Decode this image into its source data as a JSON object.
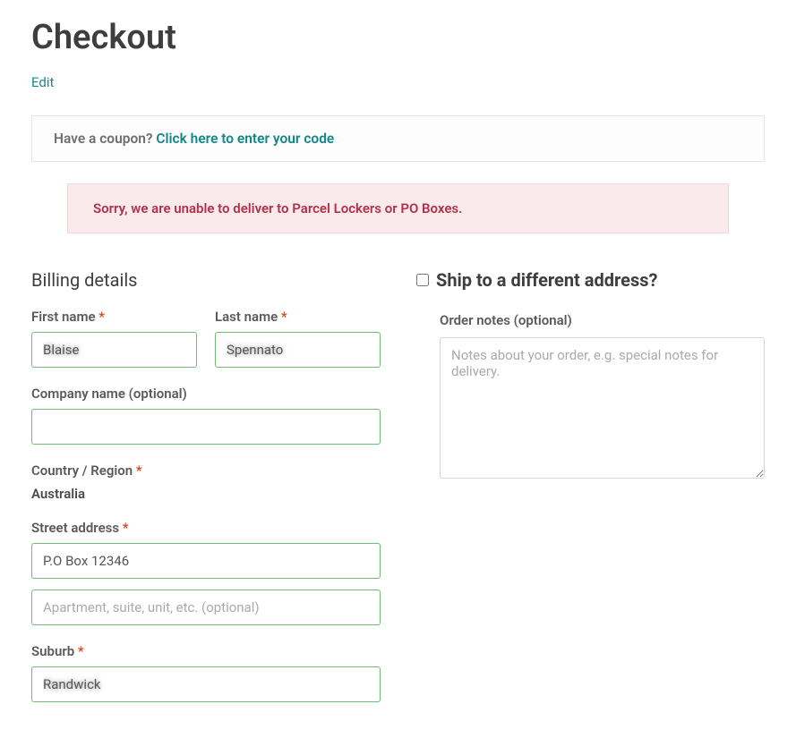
{
  "page": {
    "title": "Checkout",
    "edit_link": "Edit"
  },
  "coupon": {
    "prompt": "Have a coupon? ",
    "link": "Click here to enter your code"
  },
  "error": {
    "message": "Sorry, we are unable to deliver to Parcel Lockers or PO Boxes."
  },
  "billing": {
    "heading": "Billing details",
    "first_name": {
      "label": "First name ",
      "value": "Blaise"
    },
    "last_name": {
      "label": "Last name ",
      "value": "Spennato"
    },
    "company": {
      "label": "Company name (optional)",
      "value": ""
    },
    "country": {
      "label": "Country / Region ",
      "value": "Australia"
    },
    "street": {
      "label": "Street address ",
      "value": "P.O Box 12346",
      "placeholder2": "Apartment, suite, unit, etc. (optional)"
    },
    "suburb": {
      "label": "Suburb ",
      "value": "Randwick"
    },
    "required_marker": "*"
  },
  "shipping": {
    "heading": "Ship to a different address?"
  },
  "notes": {
    "label": "Order notes (optional)",
    "placeholder": "Notes about your order, e.g. special notes for delivery."
  }
}
